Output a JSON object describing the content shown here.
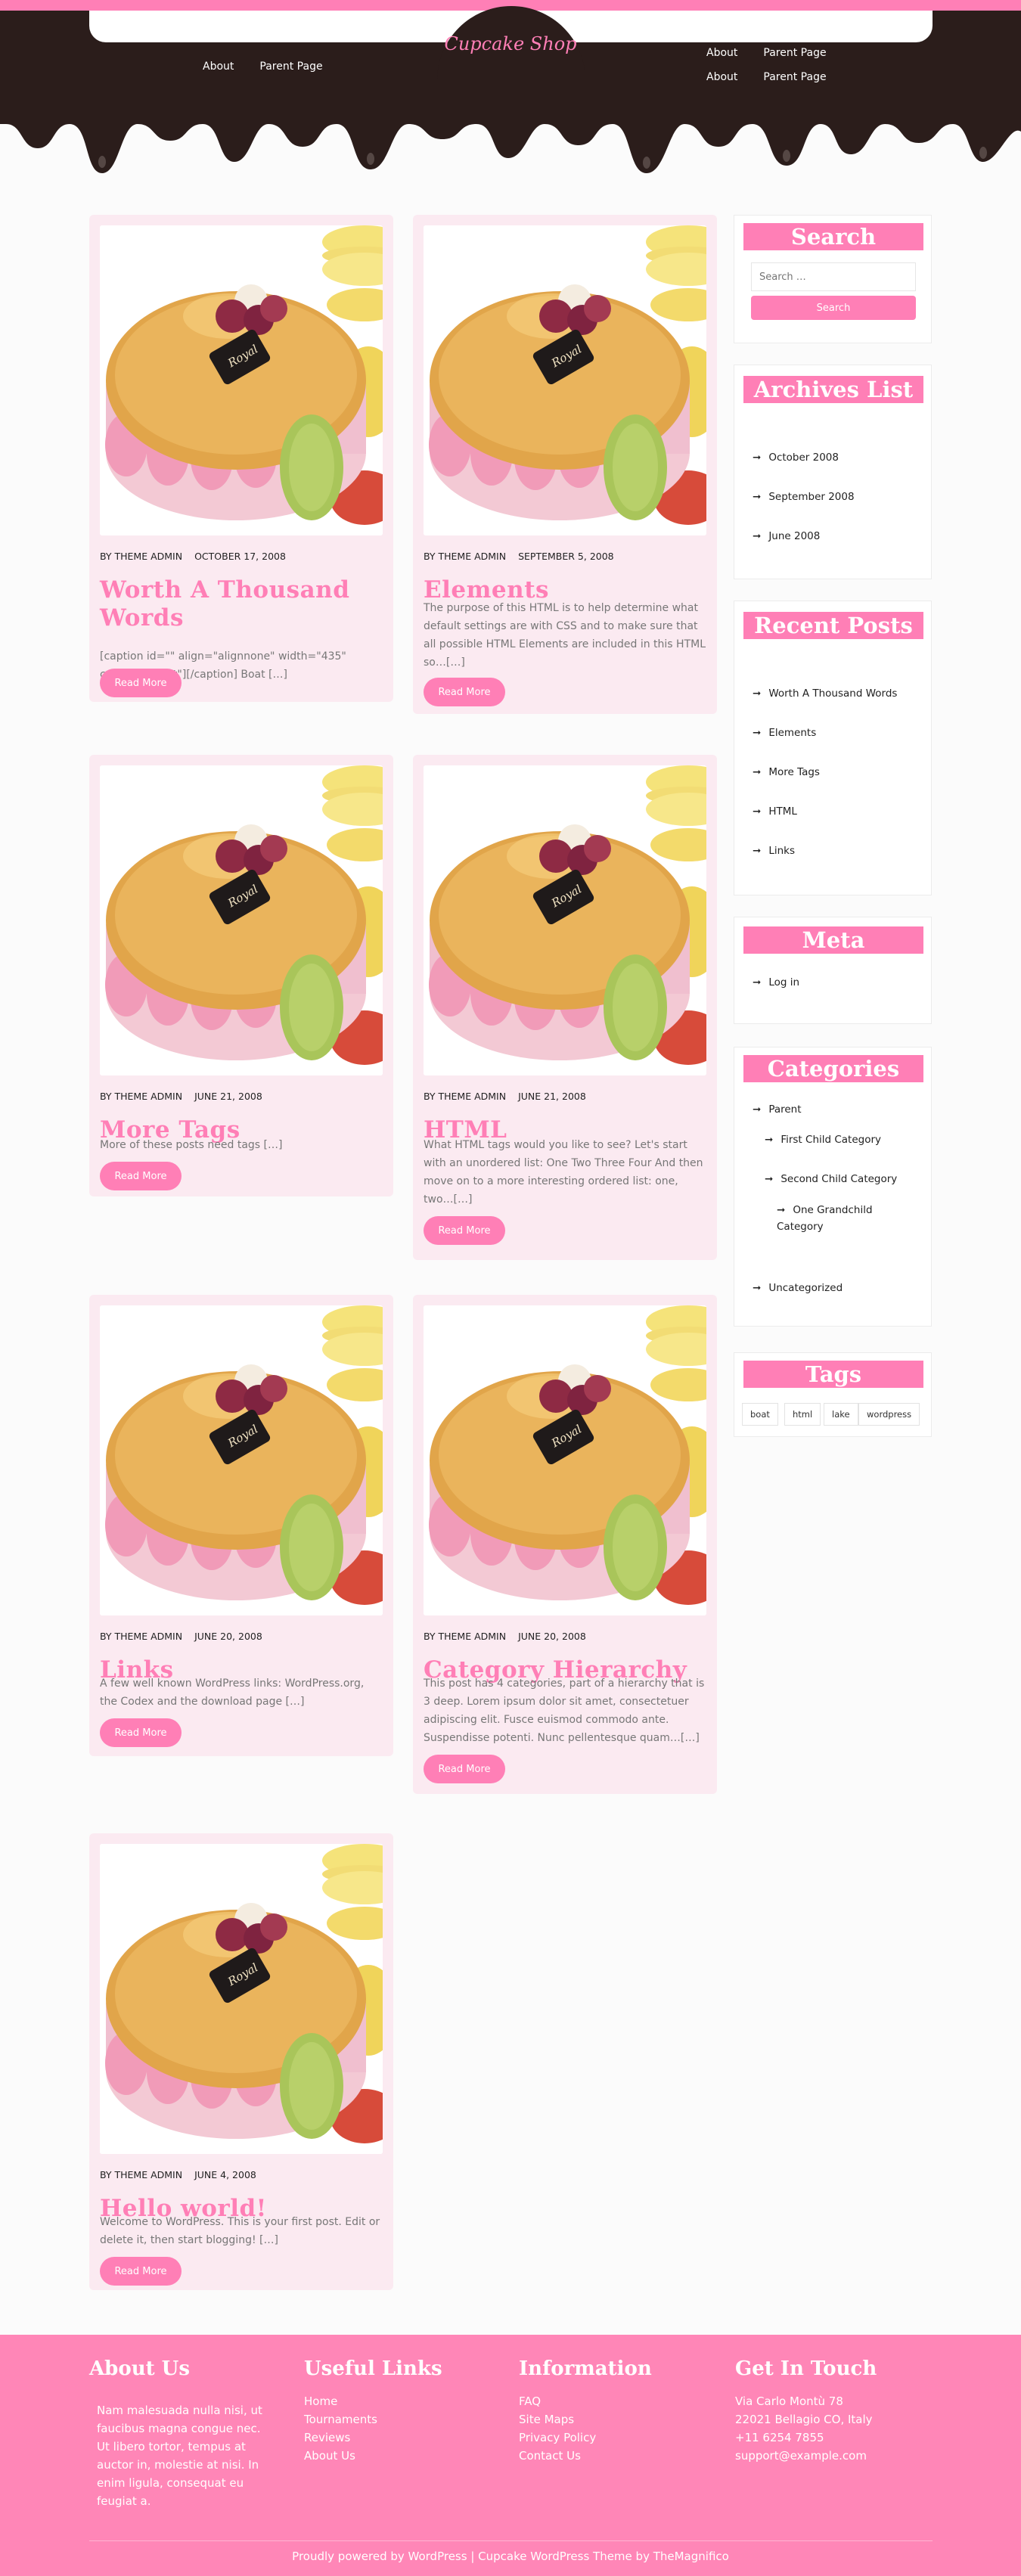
{
  "header": {
    "site_title": "Cupcake Shop",
    "nav_left": [
      "About",
      "Parent Page"
    ],
    "nav_right_row1": [
      "About",
      "Parent Page"
    ],
    "nav_right_row2": [
      "About",
      "Parent Page"
    ]
  },
  "posts": [
    {
      "author": "BY THEME ADMIN",
      "date": "OCTOBER 17, 2008",
      "title": "Worth A Thousand Words",
      "excerpt": "[caption id=\"\" align=\"alignnone\" width=\"435\" caption=\"Boat\"][/caption] Boat […]",
      "button": "Read More"
    },
    {
      "author": "BY THEME ADMIN",
      "date": "SEPTEMBER 5, 2008",
      "title": "Elements",
      "excerpt": "The purpose of this HTML is to help determine what default settings are with CSS and to make sure that all possible HTML Elements are included in this HTML so…[…]",
      "button": "Read More"
    },
    {
      "author": "BY THEME ADMIN",
      "date": "JUNE 21, 2008",
      "title": "More Tags",
      "excerpt": "More of these posts need tags […]",
      "button": "Read More"
    },
    {
      "author": "BY THEME ADMIN",
      "date": "JUNE 21, 2008",
      "title": "HTML",
      "excerpt": "What HTML tags would you like to see? Let's start with an unordered list: One Two Three Four And then move on to a more interesting ordered list: one, two…[…]",
      "button": "Read More"
    },
    {
      "author": "BY THEME ADMIN",
      "date": "JUNE 20, 2008",
      "title": "Links",
      "excerpt": "A few well known WordPress links: WordPress.org, the Codex and the download page […]",
      "button": "Read More"
    },
    {
      "author": "BY THEME ADMIN",
      "date": "JUNE 20, 2008",
      "title": "Category Hierarchy",
      "excerpt": "This post has 4 categories, part of a hierarchy that is 3 deep. Lorem ipsum dolor sit amet, consectetuer adipiscing elit. Fusce euismod commodo ante. Suspendisse potenti. Nunc pellentesque quam…[…]",
      "button": "Read More"
    },
    {
      "author": "BY THEME ADMIN",
      "date": "JUNE 4, 2008",
      "title": "Hello world!",
      "excerpt": "Welcome to WordPress. This is your first post. Edit or delete it, then start blogging! […]",
      "button": "Read More"
    }
  ],
  "sidebar": {
    "search": {
      "title": "Search",
      "placeholder": "Search …",
      "button": "Search"
    },
    "archives": {
      "title": "Archives List",
      "items": [
        "October 2008",
        "September 2008",
        "June 2008"
      ]
    },
    "recent": {
      "title": "Recent Posts",
      "items": [
        "Worth A Thousand Words",
        "Elements",
        "More Tags",
        "HTML",
        "Links"
      ]
    },
    "meta": {
      "title": "Meta",
      "items": [
        "Log in"
      ]
    },
    "categories": {
      "title": "Categories",
      "items": [
        "Parent",
        "First Child Category",
        "Second Child Category",
        "One Grandchild Category",
        "Uncategorized"
      ]
    },
    "tags": {
      "title": "Tags",
      "items": [
        "boat",
        "html",
        "lake",
        "wordpress"
      ]
    }
  },
  "footer": {
    "about": {
      "title": "About Us",
      "text": "Nam malesuada nulla nisi, ut faucibus magna congue nec. Ut libero tortor, tempus at auctor in, molestie at nisi. In enim ligula, consequat eu feugiat a."
    },
    "useful": {
      "title": "Useful Links",
      "items": [
        "Home",
        "Tournaments",
        "Reviews",
        "About Us"
      ]
    },
    "info": {
      "title": "Information",
      "items": [
        "FAQ",
        "Site Maps",
        "Privacy Policy",
        "Contact Us"
      ]
    },
    "contact": {
      "title": "Get In Touch",
      "items": [
        "Via Carlo Montù 78",
        "22021 Bellagio CO, Italy",
        "+11 6254 7855",
        "support@example.com"
      ]
    },
    "copyright": "Proudly powered by WordPress | Cupcake WordPress Theme by TheMagnifico"
  },
  "colors": {
    "accent": "#ff7fb6",
    "chocolate": "#2b1d1b",
    "card": "#fbeaf1",
    "footer": "#ff86b7"
  },
  "icons": {
    "list_arrow": "right-arrow-icon"
  }
}
